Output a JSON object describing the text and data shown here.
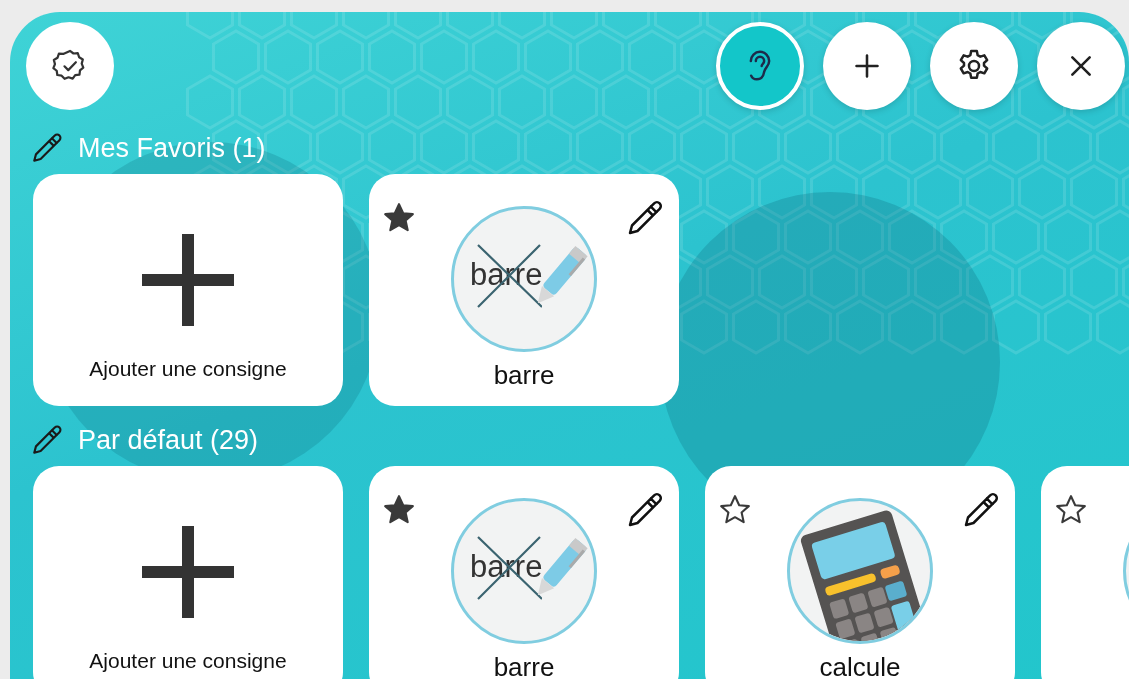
{
  "top_bar": {
    "buttons": [
      {
        "selected": true
      },
      {
        "selected": false
      },
      {
        "selected": false
      },
      {
        "selected": false
      }
    ]
  },
  "sections": [
    {
      "title": "Mes Favoris (1)",
      "cards": [
        {
          "kind": "add",
          "label": "Ajouter une consigne"
        },
        {
          "kind": "crossout",
          "favorite": true,
          "picture_text": "barre",
          "label": "barre"
        }
      ]
    },
    {
      "title": "Par défaut (29)",
      "cards": [
        {
          "kind": "add",
          "label": "Ajouter une consigne"
        },
        {
          "kind": "crossout",
          "favorite": true,
          "picture_text": "barre",
          "label": "barre"
        },
        {
          "kind": "calculator",
          "favorite": false,
          "label": "calcule"
        },
        {
          "kind": "blank",
          "favorite": false
        }
      ]
    }
  ]
}
